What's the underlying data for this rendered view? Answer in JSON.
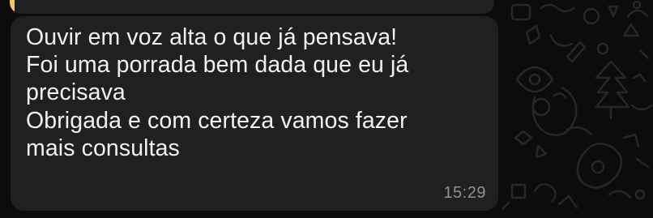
{
  "message": {
    "lines": [
      "Ouvir em voz alta o que já pensava!",
      "Foi uma porrada bem dada que eu já",
      "precisava",
      "Obrigada e com certeza vamos fazer",
      "mais consultas"
    ],
    "time": "15:29"
  },
  "colors": {
    "background": "#0b0c0c",
    "bubble": "#1f2020",
    "text": "#f1f1f1",
    "timestamp": "#8e9294",
    "reply_accent": "#f3c26b",
    "doodle": "#262828"
  }
}
